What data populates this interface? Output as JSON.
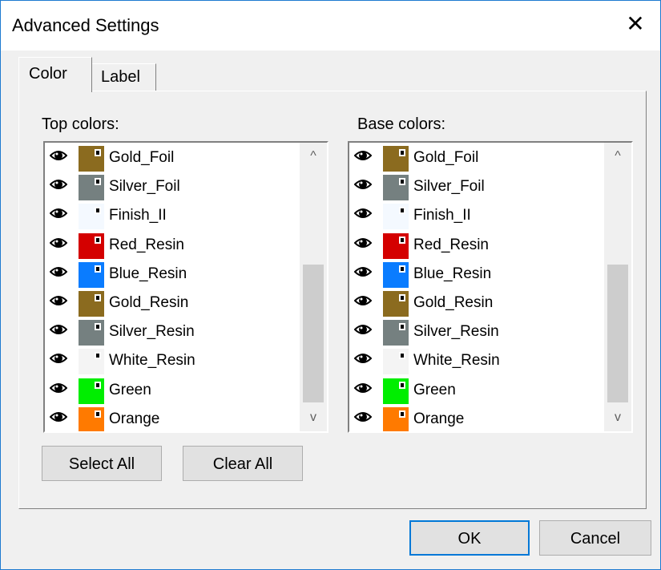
{
  "window": {
    "title": "Advanced Settings",
    "close_symbol": "✕"
  },
  "tabs": [
    {
      "label": "Color",
      "selected": true
    },
    {
      "label": "Label",
      "selected": false
    }
  ],
  "top_colors": {
    "label": "Top colors:",
    "items": [
      {
        "name": "Gold_Foil",
        "color": "#8b6b1f",
        "visible": true
      },
      {
        "name": "Silver_Foil",
        "color": "#758080",
        "visible": true
      },
      {
        "name": "Finish_II",
        "color": "#f4f9ff",
        "visible": true
      },
      {
        "name": "Red_Resin",
        "color": "#d40000",
        "visible": true
      },
      {
        "name": "Blue_Resin",
        "color": "#0a7cff",
        "visible": true
      },
      {
        "name": "Gold_Resin",
        "color": "#8b6b1f",
        "visible": true
      },
      {
        "name": "Silver_Resin",
        "color": "#758080",
        "visible": true
      },
      {
        "name": "White_Resin",
        "color": "#f4f4f4",
        "visible": true
      },
      {
        "name": "Green",
        "color": "#00ee00",
        "visible": true
      },
      {
        "name": "Orange",
        "color": "#ff7a00",
        "visible": true
      }
    ]
  },
  "base_colors": {
    "label": "Base colors:",
    "items": [
      {
        "name": "Gold_Foil",
        "color": "#8b6b1f",
        "visible": true
      },
      {
        "name": "Silver_Foil",
        "color": "#758080",
        "visible": true
      },
      {
        "name": "Finish_II",
        "color": "#f4f9ff",
        "visible": true
      },
      {
        "name": "Red_Resin",
        "color": "#d40000",
        "visible": true
      },
      {
        "name": "Blue_Resin",
        "color": "#0a7cff",
        "visible": true
      },
      {
        "name": "Gold_Resin",
        "color": "#8b6b1f",
        "visible": true
      },
      {
        "name": "Silver_Resin",
        "color": "#758080",
        "visible": true
      },
      {
        "name": "White_Resin",
        "color": "#f4f4f4",
        "visible": true
      },
      {
        "name": "Green",
        "color": "#00ee00",
        "visible": true
      },
      {
        "name": "Orange",
        "color": "#ff7a00",
        "visible": true
      }
    ]
  },
  "scroll_arrows": {
    "up": "^",
    "down": "v"
  },
  "buttons": {
    "select_all": "Select All",
    "clear_all": "Clear All",
    "ok": "OK",
    "cancel": "Cancel"
  },
  "icons": {
    "visibility": "eye-icon"
  }
}
